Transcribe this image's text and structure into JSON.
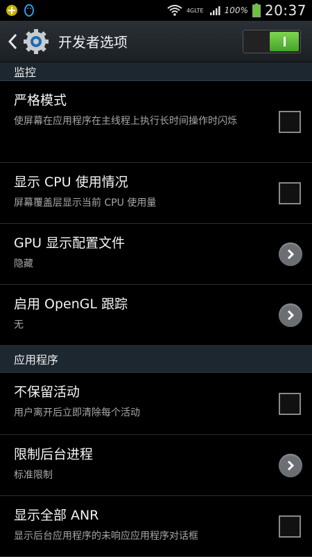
{
  "status_bar": {
    "time": "20:37",
    "battery": "100%",
    "network": "4GLTE",
    "icons": [
      "notification-plus-icon",
      "qq-penguin-icon",
      "wifi-icon",
      "signal-icon",
      "battery-icon"
    ]
  },
  "action_bar": {
    "title": "开发者选项",
    "back_icon": "chevron-left-icon",
    "settings_icon": "gear-icon",
    "switch_on": true
  },
  "sections": {
    "monitoring": "监控",
    "apps": "应用程序"
  },
  "items": [
    {
      "title": "严格模式",
      "summary": "使屏幕在应用程序在主线程上执行长时间操作时闪烁",
      "control": "checkbox",
      "checked": false
    },
    {
      "title": "显示 CPU 使用情况",
      "summary": "屏幕覆盖层显示当前 CPU 使用量",
      "control": "checkbox",
      "checked": false
    },
    {
      "title": "GPU 显示配置文件",
      "summary": "隐藏",
      "control": "chevron"
    },
    {
      "title": "启用 OpenGL 跟踪",
      "summary": "无",
      "control": "chevron"
    },
    {
      "title": "不保留活动",
      "summary": "用户离开后立即清除每个活动",
      "control": "checkbox",
      "checked": false
    },
    {
      "title": "限制后台进程",
      "summary": "标准限制",
      "control": "chevron"
    },
    {
      "title": "显示全部 ANR",
      "summary": "显示后台应用程序的未响应应用程序对话框",
      "control": "checkbox",
      "checked": false
    }
  ],
  "colors": {
    "accent_green": "#5cbf3a",
    "battery_green": "#6ac43c",
    "header_bg": "#1c2730"
  }
}
